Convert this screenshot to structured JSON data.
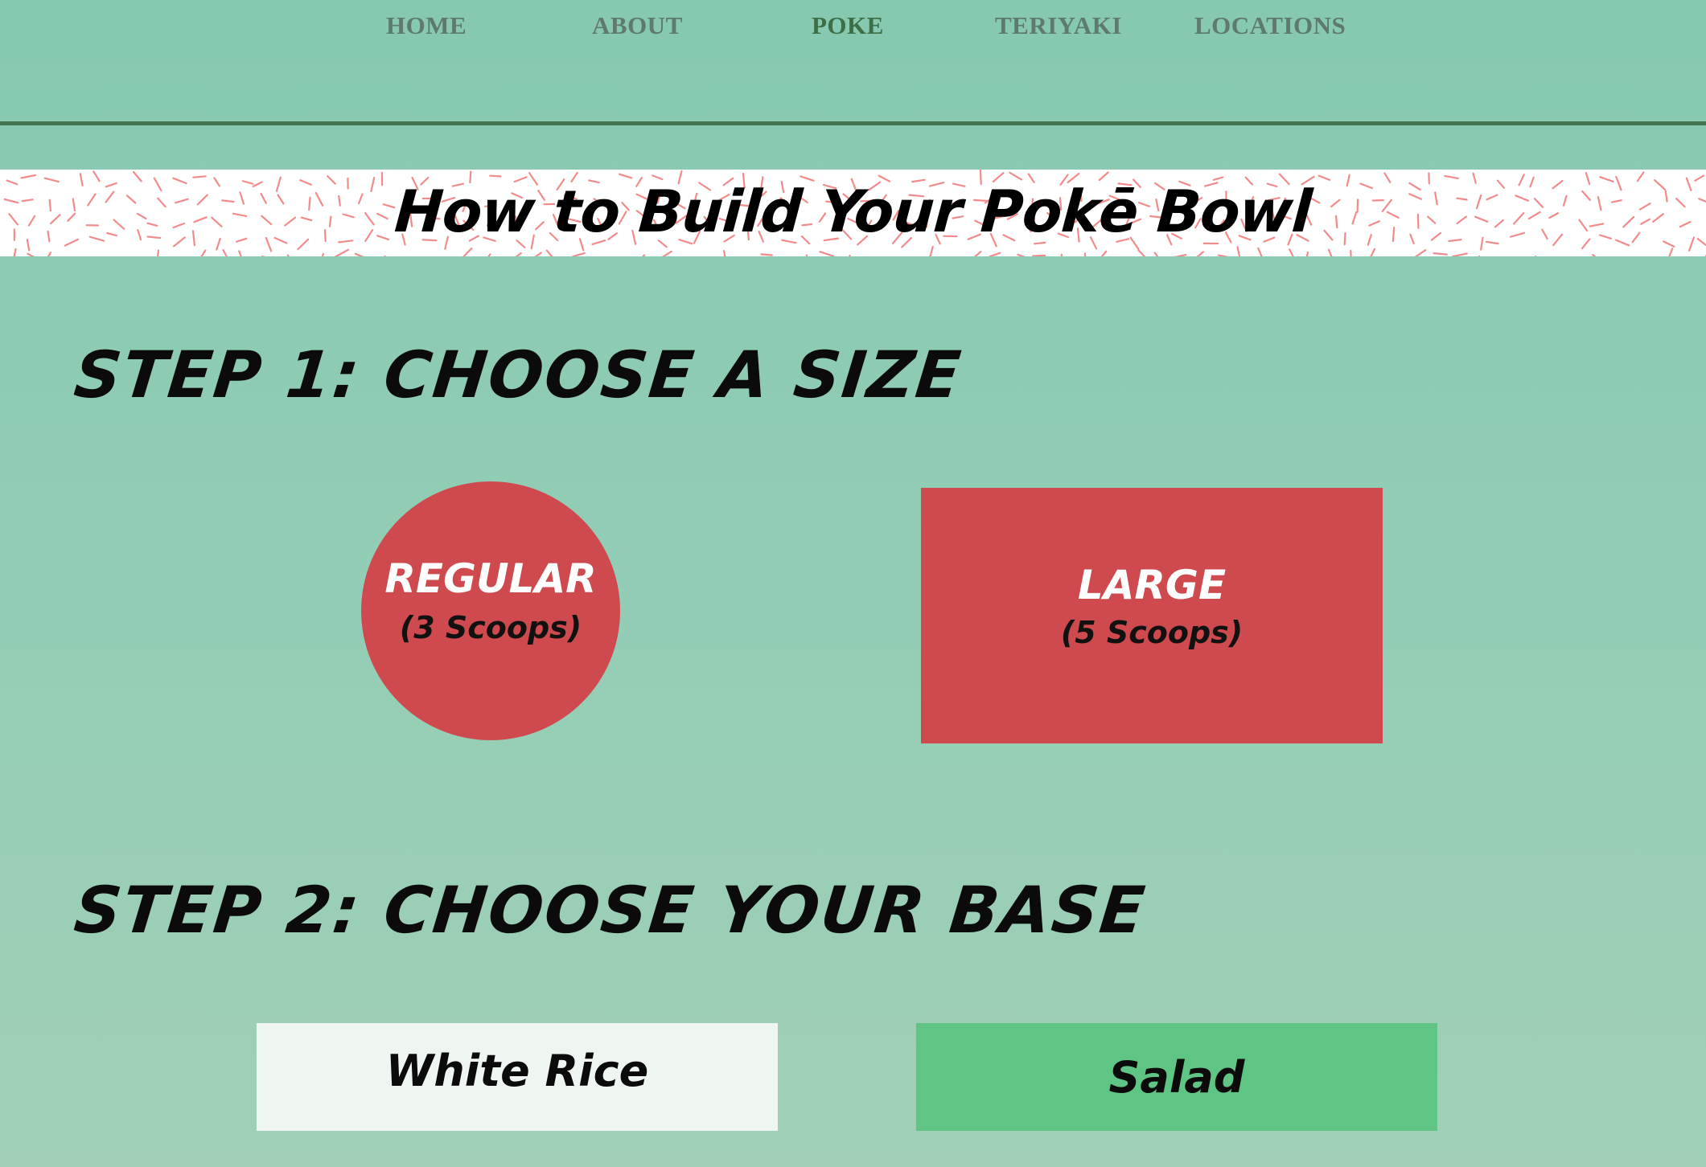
{
  "nav": {
    "items": [
      {
        "label": "HOME",
        "active": false
      },
      {
        "label": "ABOUT",
        "active": false
      },
      {
        "label": "POKE",
        "active": true
      },
      {
        "label": "TERIYAKI",
        "active": false
      },
      {
        "label": "LOCATIONS",
        "active": false
      }
    ]
  },
  "banner": {
    "title": "How to Build Your Pokē Bowl"
  },
  "step1": {
    "heading": "STEP 1: CHOOSE A SIZE",
    "sizes": [
      {
        "name": "REGULAR",
        "detail": "(3 Scoops)"
      },
      {
        "name": "LARGE",
        "detail": "(5 Scoops)"
      }
    ]
  },
  "step2": {
    "heading": "STEP 2: CHOOSE YOUR BASE",
    "bases": [
      {
        "label": "White Rice"
      },
      {
        "label": "Salad"
      }
    ]
  },
  "colors": {
    "background": "#8fcab3",
    "accent_red": "#cf4a4f",
    "salad_green": "#5fc584",
    "nav_active": "#3c6f48",
    "nav_text": "#5e7a6d",
    "divider": "#43734f",
    "sprinkle": "#f28b8b"
  }
}
